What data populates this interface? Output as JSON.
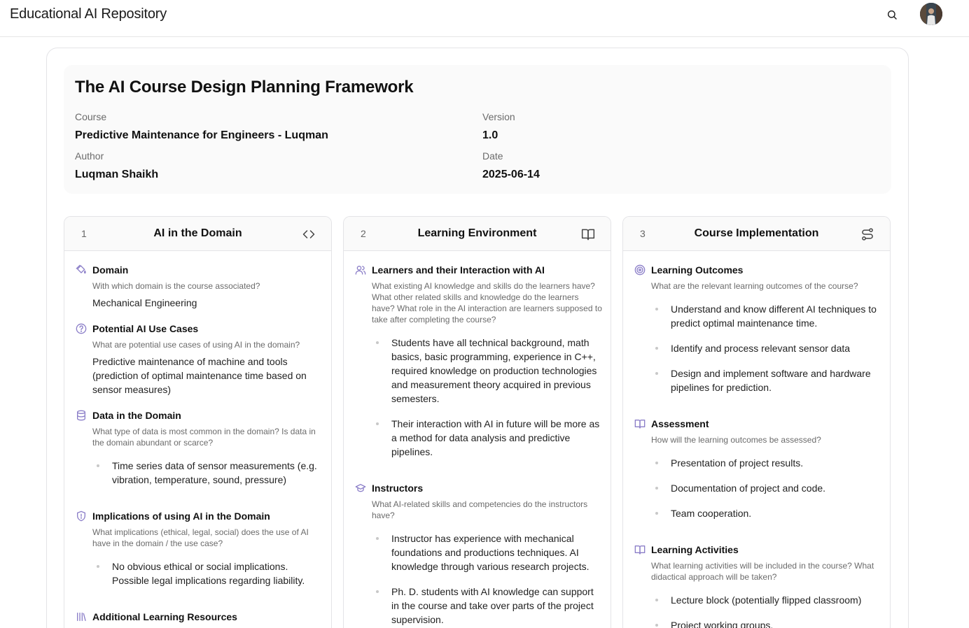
{
  "app": {
    "title": "Educational AI Repository"
  },
  "doc": {
    "title": "The AI Course Design Planning Framework",
    "course_label": "Course",
    "course": "Predictive Maintenance for Engineers - Luqman",
    "version_label": "Version",
    "version": "1.0",
    "author_label": "Author",
    "author": "Luqman Shaikh",
    "date_label": "Date",
    "date": "2025-06-14"
  },
  "columns": [
    {
      "num": "1",
      "title": "AI in the Domain",
      "icon": "code-icon",
      "sections": [
        {
          "icon": "paint-bucket-icon",
          "title": "Domain",
          "question": "With which domain is the course associated?",
          "answer": "Mechanical Engineering"
        },
        {
          "icon": "help-circle-icon",
          "title": "Potential AI Use Cases",
          "question": "What are potential use cases of using AI in the domain?",
          "answer": "Predictive maintenance of machine and tools (prediction of optimal maintenance time based on sensor measures)"
        },
        {
          "icon": "database-icon",
          "title": "Data in the Domain",
          "question": "What type of data is most common in the domain? Is data in the domain abundant or scarce?",
          "bullets": [
            "Time series data of sensor measurements (e.g. vibration, temperature, sound, pressure)"
          ]
        },
        {
          "icon": "shield-alert-icon",
          "title": "Implications of using AI in the Domain",
          "question": "What implications (ethical, legal, social) does the use of AI have in the domain / the use case?",
          "bullets": [
            "No obvious ethical or social implications. Possible legal implications regarding liability."
          ]
        },
        {
          "icon": "library-icon",
          "title": "Additional Learning Resources"
        }
      ]
    },
    {
      "num": "2",
      "title": "Learning Environment",
      "icon": "book-open-icon",
      "sections": [
        {
          "icon": "users-icon",
          "title": "Learners and their Interaction with AI",
          "question": "What existing AI knowledge and skills do the learners have? What other related skills and knowledge do the learners have? What role in the AI interaction are learners supposed to take after completing the course?",
          "bullets": [
            "Students have all technical background, math basics, basic programming, experience in C++, required knowledge on production technologies and measurement theory acquired in previous semesters.",
            "Their interaction with AI in future will be more as a method for data analysis and predictive pipelines."
          ]
        },
        {
          "icon": "graduation-cap-icon",
          "title": "Instructors",
          "question": "What AI-related skills and competencies do the instructors have?",
          "bullets": [
            "Instructor has experience with mechanical foundations and productions techniques. AI knowledge through various research projects.",
            "Ph. D. students with AI knowledge can support in the course and take over parts of the project supervision."
          ]
        }
      ]
    },
    {
      "num": "3",
      "title": "Course Implementation",
      "icon": "route-icon",
      "sections": [
        {
          "icon": "target-icon",
          "title": "Learning Outcomes",
          "question": "What are the relevant learning outcomes of the course?",
          "bullets": [
            "Understand and know different AI techniques to predict optimal maintenance time.",
            "Identify and process relevant sensor data",
            "Design and implement software and hardware pipelines for prediction."
          ]
        },
        {
          "icon": "book-open-icon",
          "title": "Assessment",
          "question": "How will the learning outcomes be assessed?",
          "bullets": [
            "Presentation of project results.",
            "Documentation of project and code.",
            "Team cooperation."
          ]
        },
        {
          "icon": "book-open-icon",
          "title": "Learning Activities",
          "question": "What learning activities will be included in the course? What didactical approach will be taken?",
          "bullets": [
            "Lecture block (potentially flipped classroom)",
            "Project working groups."
          ]
        }
      ]
    }
  ]
}
